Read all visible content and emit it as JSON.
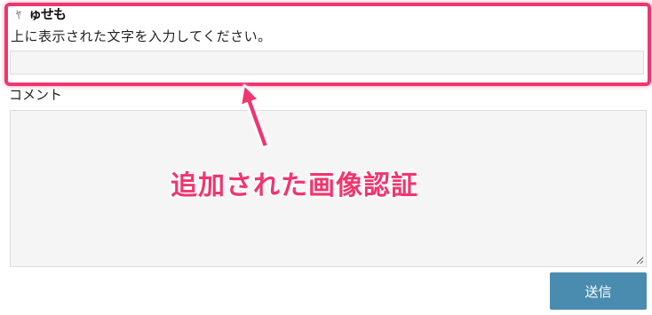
{
  "captcha": {
    "image_text": "ゅせも",
    "instruction": "上に表示された文字を入力してください。",
    "input_value": ""
  },
  "comment": {
    "label": "コメント",
    "value": ""
  },
  "annotation": {
    "caption": "追加された画像認証",
    "color": "#f0366f"
  },
  "submit": {
    "label": "送信",
    "color": "#4a8cb0"
  }
}
